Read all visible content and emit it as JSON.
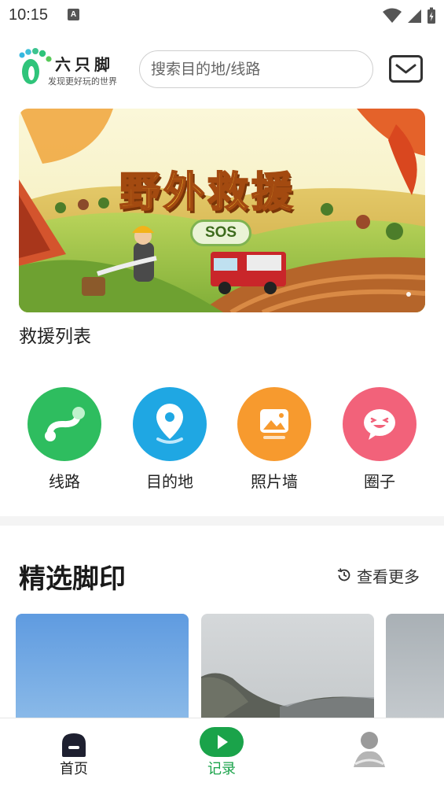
{
  "status_bar": {
    "time": "10:15",
    "notification_badge": "A"
  },
  "header": {
    "brand_name": "六只脚",
    "brand_slogan": "发现更好玩的世界",
    "search_placeholder": "搜索目的地/线路"
  },
  "banner": {
    "title": "野外救援",
    "badge": "SOS"
  },
  "section_label": "救援列表",
  "entries": [
    {
      "label": "线路",
      "icon": "route-icon",
      "color": "#2ebd5f"
    },
    {
      "label": "目的地",
      "icon": "location-pin-icon",
      "color": "#1fa7e3"
    },
    {
      "label": "照片墙",
      "icon": "photo-icon",
      "color": "#f79a2e"
    },
    {
      "label": "圈子",
      "icon": "chat-smile-icon",
      "color": "#f2627a"
    }
  ],
  "featured": {
    "title": "精选脚印",
    "more_label": "查看更多"
  },
  "tabbar": {
    "tabs": [
      {
        "label": "首页",
        "icon": "home-icon",
        "active": false
      },
      {
        "label": "记录",
        "icon": "play-record-icon",
        "active": true
      },
      {
        "label": "",
        "icon": "profile-avatar-icon",
        "active": false
      }
    ],
    "active_color": "#1aa34a"
  }
}
